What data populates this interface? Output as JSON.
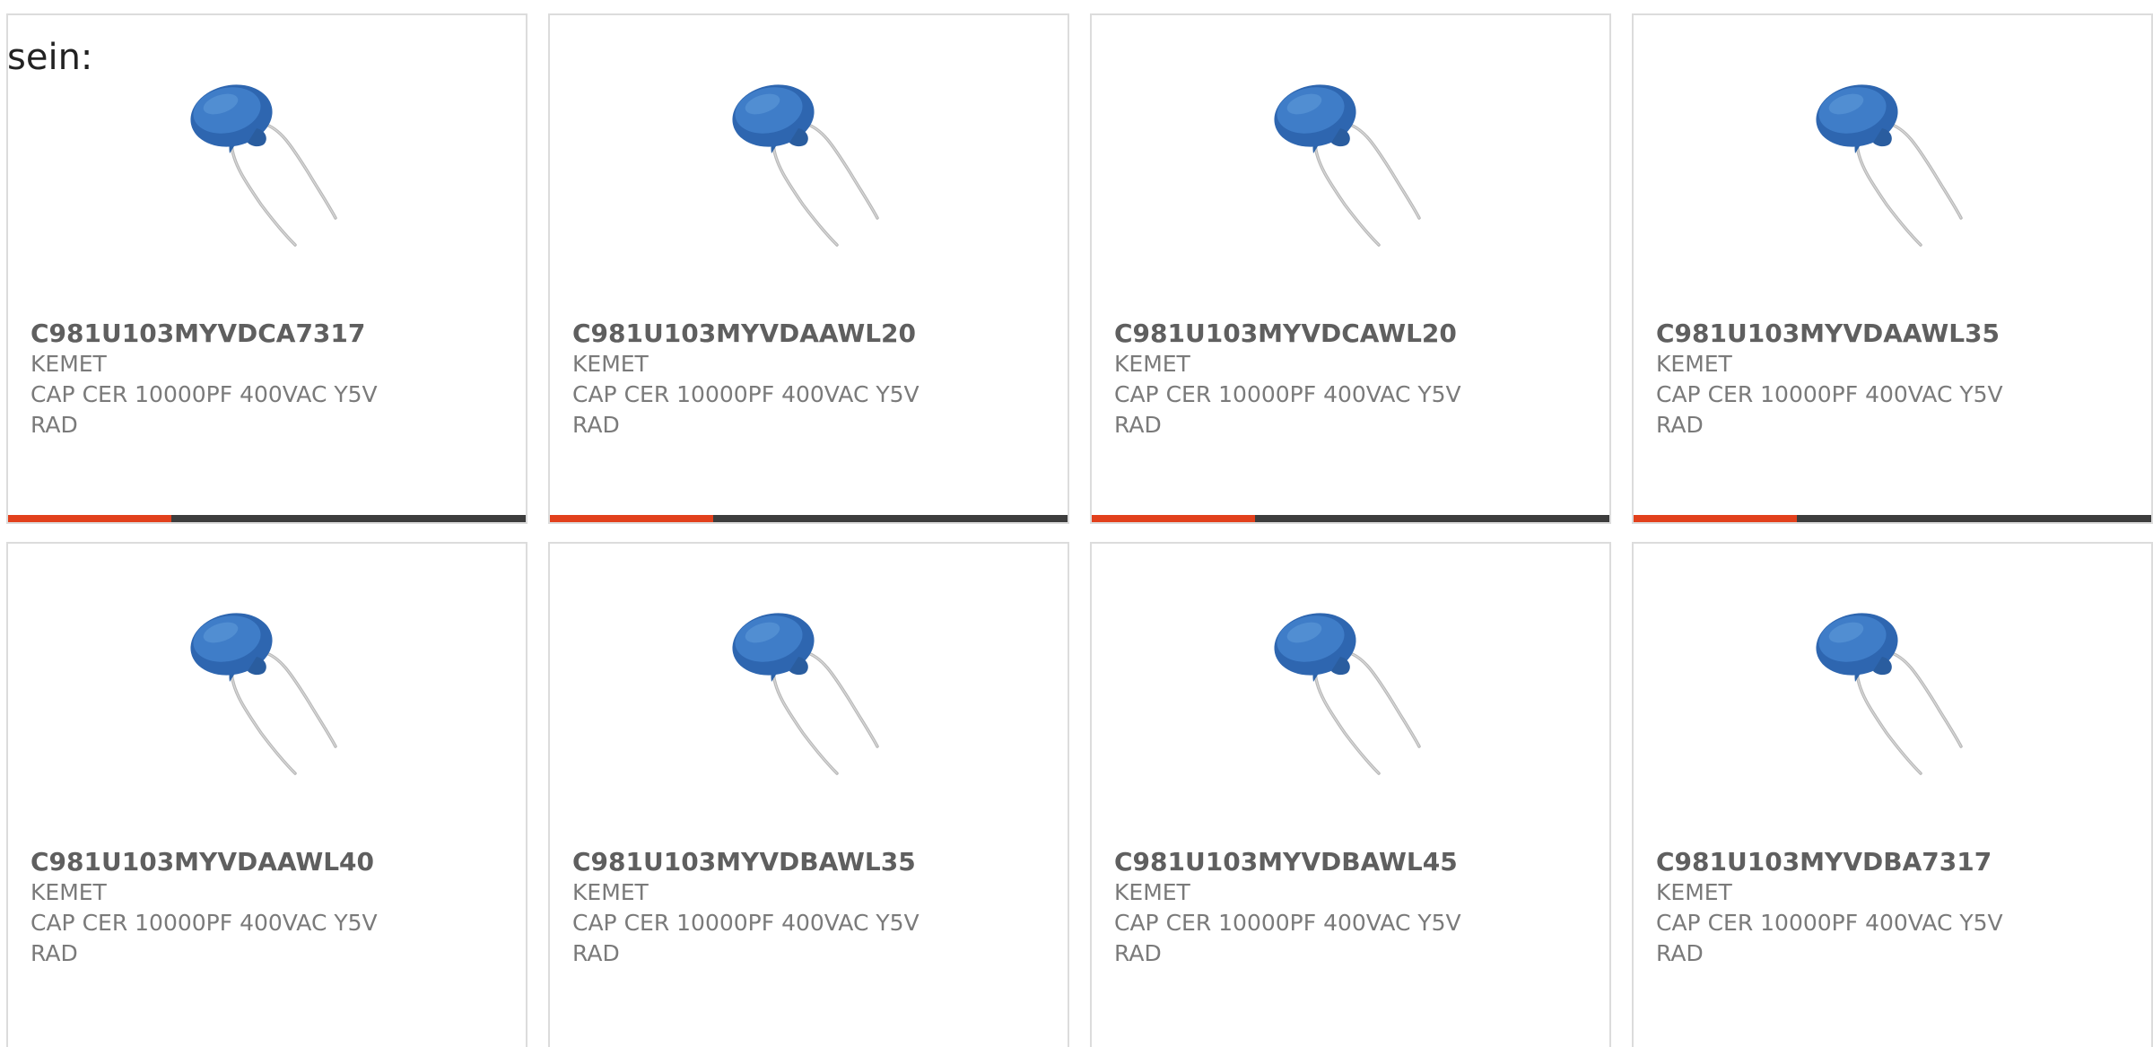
{
  "intro_text": "sein:",
  "accent_color": "#e2401c",
  "bar_color": "#3d3d3d",
  "product_image_icon": "ceramic-disc-capacitor-icon",
  "products": [
    {
      "part_number": "C981U103MYVDCA7317",
      "manufacturer": "KEMET",
      "description": "CAP CER 10000PF 400VAC Y5V RAD",
      "bar_fill": 0.315
    },
    {
      "part_number": "C981U103MYVDAAWL20",
      "manufacturer": "KEMET",
      "description": "CAP CER 10000PF 400VAC Y5V RAD",
      "bar_fill": 0.315
    },
    {
      "part_number": "C981U103MYVDCAWL20",
      "manufacturer": "KEMET",
      "description": "CAP CER 10000PF 400VAC Y5V RAD",
      "bar_fill": 0.315
    },
    {
      "part_number": "C981U103MYVDAAWL35",
      "manufacturer": "KEMET",
      "description": "CAP CER 10000PF 400VAC Y5V RAD",
      "bar_fill": 0.315
    },
    {
      "part_number": "C981U103MYVDAAWL40",
      "manufacturer": "KEMET",
      "description": "CAP CER 10000PF 400VAC Y5V RAD"
    },
    {
      "part_number": "C981U103MYVDBAWL35",
      "manufacturer": "KEMET",
      "description": "CAP CER 10000PF 400VAC Y5V RAD"
    },
    {
      "part_number": "C981U103MYVDBAWL45",
      "manufacturer": "KEMET",
      "description": "CAP CER 10000PF 400VAC Y5V RAD"
    },
    {
      "part_number": "C981U103MYVDBA7317",
      "manufacturer": "KEMET",
      "description": "CAP CER 10000PF 400VAC Y5V RAD"
    }
  ]
}
